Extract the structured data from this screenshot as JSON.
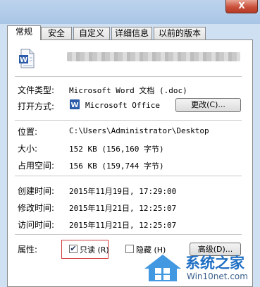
{
  "window": {
    "close_label": "X"
  },
  "tabs": [
    {
      "label": "常规"
    },
    {
      "label": "安全"
    },
    {
      "label": "自定义"
    },
    {
      "label": "详细信息"
    },
    {
      "label": "以前的版本"
    }
  ],
  "file": {
    "icon": "word-document-icon"
  },
  "properties": {
    "type_label": "文件类型:",
    "type_value": "Microsoft Word 文档 (.doc)",
    "open_label": "打开方式:",
    "open_value": "Microsoft Office Wo",
    "change_button": "更改(C)...",
    "location_label": "位置:",
    "location_value": "C:\\Users\\Administrator\\Desktop",
    "size_label": "大小:",
    "size_value": "152 KB (156,160 字节)",
    "disk_label": "占用空间:",
    "disk_value": "156 KB (159,744 字节)",
    "created_label": "创建时间:",
    "created_value": "2015年11月19日, 17:29:00",
    "modified_label": "修改时间:",
    "modified_value": "2015年11月21日, 12:25:07",
    "accessed_label": "访问时间:",
    "accessed_value": "2015年11月21日, 12:25:07",
    "attr_label": "属性:",
    "readonly_label": "只读 (R)",
    "readonly_checked": true,
    "hidden_label": "隐藏 (H)",
    "hidden_checked": false,
    "advanced_button": "高级(D)..."
  },
  "watermark": {
    "text": "系统之家",
    "url": "Win10net.com"
  },
  "colors": {
    "highlight_box": "#d23a3a",
    "brand_blue": "#1f6fc4"
  }
}
